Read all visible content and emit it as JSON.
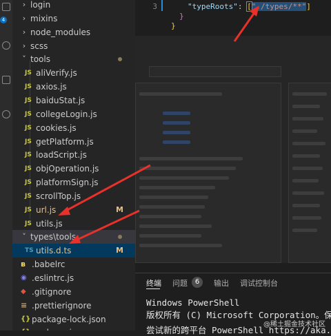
{
  "activity_bar": {
    "badge_count": "4"
  },
  "explorer": {
    "items": [
      {
        "label": "login",
        "kind": "folder",
        "state": "collapsed",
        "badge": "",
        "dot": false
      },
      {
        "label": "mixins",
        "kind": "folder",
        "state": "collapsed",
        "badge": "",
        "dot": false
      },
      {
        "label": "node_modules",
        "kind": "folder",
        "state": "collapsed",
        "badge": "",
        "dot": false
      },
      {
        "label": "scss",
        "kind": "folder",
        "state": "collapsed",
        "badge": "",
        "dot": false
      },
      {
        "label": "tools",
        "kind": "folder",
        "state": "expanded",
        "badge": "",
        "dot": true
      },
      {
        "label": "aliVerify.js",
        "kind": "js",
        "icon": "JS",
        "badge": "",
        "dot": false
      },
      {
        "label": "axios.js",
        "kind": "js",
        "icon": "JS",
        "badge": "",
        "dot": false
      },
      {
        "label": "baiduStat.js",
        "kind": "js",
        "icon": "JS",
        "badge": "",
        "dot": false
      },
      {
        "label": "collegeLogin.js",
        "kind": "js",
        "icon": "JS",
        "badge": "",
        "dot": false
      },
      {
        "label": "cookies.js",
        "kind": "js",
        "icon": "JS",
        "badge": "",
        "dot": false
      },
      {
        "label": "getPlatform.js",
        "kind": "js",
        "icon": "JS",
        "badge": "",
        "dot": false
      },
      {
        "label": "loadScript.js",
        "kind": "js",
        "icon": "JS",
        "badge": "",
        "dot": false
      },
      {
        "label": "objOperation.js",
        "kind": "js",
        "icon": "JS",
        "badge": "",
        "dot": false
      },
      {
        "label": "platformSign.js",
        "kind": "js",
        "icon": "JS",
        "badge": "",
        "dot": false
      },
      {
        "label": "scrollTop.js",
        "kind": "js",
        "icon": "JS",
        "badge": "",
        "dot": false
      },
      {
        "label": "url.js",
        "kind": "js-mod",
        "icon": "JS",
        "badge": "M",
        "dot": false
      },
      {
        "label": "utils.js",
        "kind": "js",
        "icon": "JS",
        "badge": "",
        "dot": false
      },
      {
        "label": "types\\tools",
        "kind": "folder-open",
        "state": "expanded",
        "badge": "",
        "dot": true
      },
      {
        "label": "utils.d.ts",
        "kind": "ts-mod",
        "icon": "TS",
        "badge": "M",
        "dot": false
      },
      {
        "label": ".babelrc",
        "kind": "babel",
        "icon": "",
        "badge": "",
        "dot": false
      },
      {
        "label": ".eslintrc.js",
        "kind": "eslint",
        "icon": "",
        "badge": "",
        "dot": false
      },
      {
        "label": ".gitignore",
        "kind": "git",
        "icon": "",
        "badge": "",
        "dot": false
      },
      {
        "label": ".prettierignore",
        "kind": "prettier",
        "icon": "",
        "badge": "",
        "dot": false
      },
      {
        "label": "package-lock.json",
        "kind": "json",
        "icon": "{}",
        "badge": "",
        "dot": false
      },
      {
        "label": "package.json",
        "kind": "json",
        "icon": "{}",
        "badge": "",
        "dot": false
      }
    ]
  },
  "editor": {
    "lines": [
      {
        "number": "3",
        "key": "\"typeRoots\"",
        "colon": ": ",
        "bracket_open": "[",
        "value": "\"./types/**\"",
        "bracket_close": "]"
      },
      {
        "number": "",
        "text": "}"
      },
      {
        "number": "",
        "text": "}"
      }
    ]
  },
  "panel": {
    "tabs": [
      {
        "label": "终端",
        "active": true
      },
      {
        "label": "问题",
        "active": false,
        "count": "6"
      },
      {
        "label": "输出",
        "active": false
      },
      {
        "label": "调试控制台",
        "active": false
      }
    ],
    "terminal_lines": [
      "Windows PowerShell",
      "版权所有 (C) Microsoft Corporation。保留",
      "尝试新的跨平台 PowerShell https://aka."
    ]
  },
  "watermark": "@稀土掘金技术社区",
  "colors": {
    "js_icon": "#cbcb41",
    "ts_icon": "#519aba",
    "modified": "#e2c08d",
    "arrow": "#e8312a",
    "selection": "#264f78"
  }
}
